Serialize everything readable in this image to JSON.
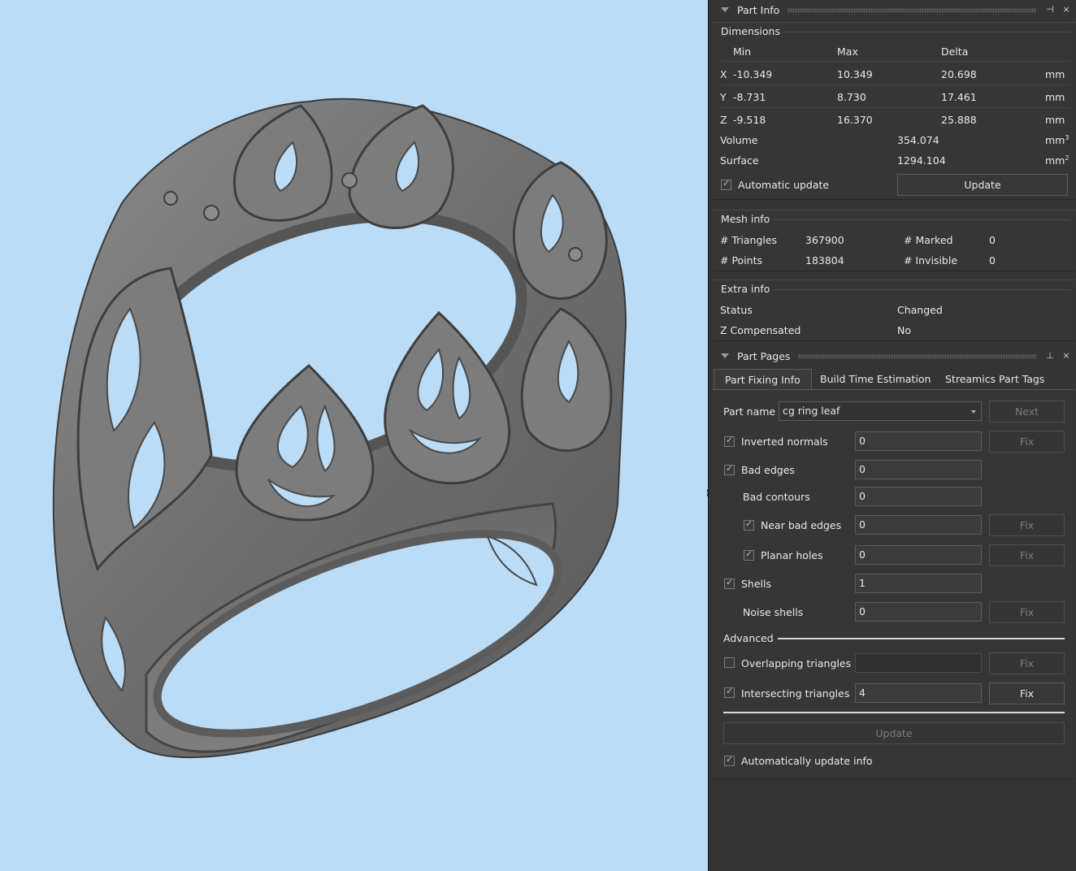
{
  "viewport": {
    "background": "#bbdcf6",
    "model_color": "#767676"
  },
  "part_info": {
    "title": "Part Info",
    "pin_icon": "pin-icon",
    "close_icon": "close-icon",
    "dimensions": {
      "label": "Dimensions",
      "headers": {
        "min": "Min",
        "max": "Max",
        "delta": "Delta"
      },
      "rows": [
        {
          "axis": "X",
          "min": "-10.349",
          "max": "10.349",
          "delta": "20.698",
          "unit": "mm"
        },
        {
          "axis": "Y",
          "min": "-8.731",
          "max": "8.730",
          "delta": "17.461",
          "unit": "mm"
        },
        {
          "axis": "Z",
          "min": "-9.518",
          "max": "16.370",
          "delta": "25.888",
          "unit": "mm"
        }
      ],
      "volume_label": "Volume",
      "volume": "354.074",
      "volume_unit": "mm",
      "surface_label": "Surface",
      "surface": "1294.104",
      "surface_unit": "mm",
      "auto_update_label": "Automatic update",
      "auto_update_checked": true,
      "update_button": "Update"
    },
    "mesh_info": {
      "label": "Mesh info",
      "triangles_label": "# Triangles",
      "triangles": "367900",
      "marked_label": "# Marked",
      "marked": "0",
      "points_label": "# Points",
      "points": "183804",
      "invisible_label": "# Invisible",
      "invisible": "0"
    },
    "extra_info": {
      "label": "Extra info",
      "status_label": "Status",
      "status": "Changed",
      "zcomp_label": "Z Compensated",
      "zcomp": "No"
    }
  },
  "part_pages": {
    "title": "Part Pages",
    "tabs": [
      {
        "label": "Part Fixing Info",
        "active": true
      },
      {
        "label": "Build Time Estimation",
        "active": false
      },
      {
        "label": "Streamics Part Tags",
        "active": false
      }
    ],
    "part_name_label": "Part name",
    "part_name": "cg ring leaf",
    "next_button": "Next",
    "fix_label": "Fix",
    "rows": {
      "inverted_normals": {
        "label": "Inverted normals",
        "value": "0",
        "checked": true
      },
      "bad_edges": {
        "label": "Bad edges",
        "value": "0",
        "checked": true
      },
      "bad_contours": {
        "label": "Bad contours",
        "value": "0"
      },
      "near_bad_edges": {
        "label": "Near bad edges",
        "value": "0",
        "checked": true
      },
      "planar_holes": {
        "label": "Planar holes",
        "value": "0",
        "checked": true
      },
      "shells": {
        "label": "Shells",
        "value": "1",
        "checked": true
      },
      "noise_shells": {
        "label": "Noise shells",
        "value": "0"
      },
      "overlapping": {
        "label": "Overlapping triangles",
        "value": "",
        "checked": false
      },
      "intersecting": {
        "label": "Intersecting triangles",
        "value": "4",
        "checked": true
      }
    },
    "advanced_label": "Advanced",
    "update_button": "Update",
    "auto_update_label": "Automatically update info",
    "auto_update_checked": true
  }
}
